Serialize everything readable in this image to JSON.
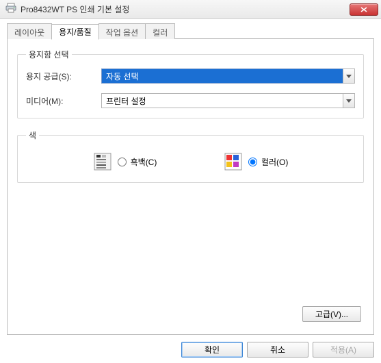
{
  "window": {
    "title": "Pro8432WT PS 인쇄 기본 설정"
  },
  "tabs": {
    "layout": "레이아웃",
    "paper_quality": "용지/품질",
    "job_options": "작업 옵션",
    "colour": "컬러"
  },
  "tray": {
    "legend": "용지함 선택",
    "source_label": "용지 공급(S):",
    "source_value": "자동 선택",
    "media_label": "미디어(M):",
    "media_value": "프린터 설정"
  },
  "color": {
    "legend": "색",
    "bw_label": "흑백(C)",
    "color_label": "컬러(O)"
  },
  "advanced_button": "고급(V)...",
  "footer": {
    "ok": "확인",
    "cancel": "취소",
    "apply": "적용(A)"
  }
}
